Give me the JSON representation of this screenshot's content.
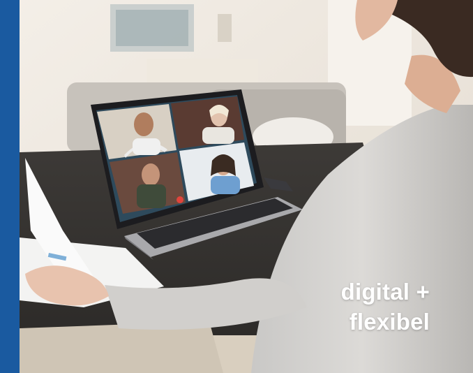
{
  "caption": {
    "line1": "digital +",
    "line2": "flexibel"
  },
  "colors": {
    "accent_bar": "#1a5aa0",
    "caption_text": "#ffffff"
  },
  "photo": {
    "video_call_tiles": 4
  }
}
